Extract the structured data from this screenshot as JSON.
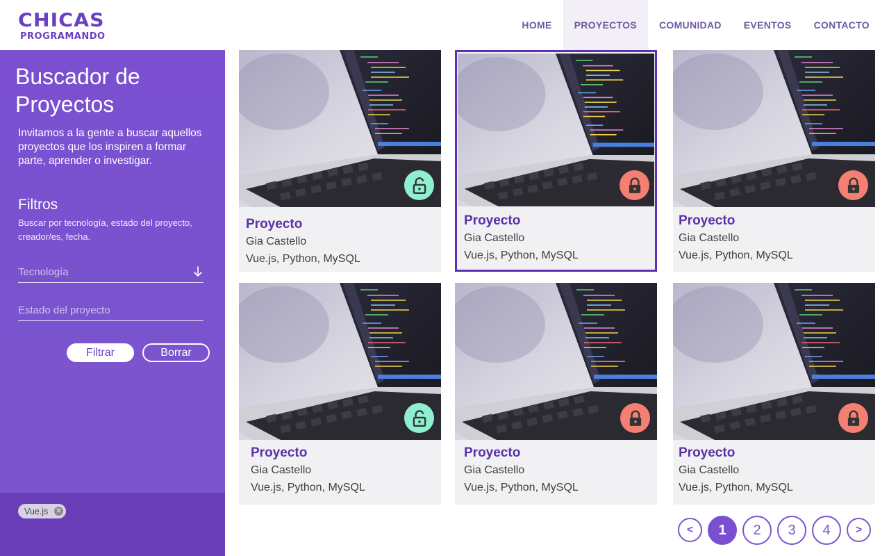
{
  "header": {
    "logo_line1": "CHICAS",
    "logo_line2": "PROGRAMANDO",
    "nav": [
      {
        "label": "HOME"
      },
      {
        "label": "PROYECTOS"
      },
      {
        "label": "COMUNIDAD"
      },
      {
        "label": "EVENTOS"
      },
      {
        "label": "CONTACTO"
      }
    ],
    "active_nav": "PROYECTOS"
  },
  "sidebar": {
    "title": "Buscador de Proyectos",
    "intro": "Invitamos a la gente a buscar aquellos proyectos que los inspiren a formar parte, aprender o investigar.",
    "filters_title": "Filtros",
    "filters_desc": "Buscar por tecnología, estado del proyecto, creador/es, fecha.",
    "tecnologia_placeholder": "Tecnología",
    "estado_placeholder": "Estado del proyecto",
    "filter_button": "Filtrar",
    "clear_button": "Borrar",
    "active_tags": [
      {
        "label": "Vue.js"
      }
    ]
  },
  "cards": [
    {
      "title": "Proyecto",
      "author": "Gia Castello",
      "tech": "Vue.js, Python, MySQL",
      "lock": "lock-open-icon",
      "lock_color": "#8ef0d1"
    },
    {
      "title": "Proyecto",
      "author": "Gia Castello",
      "tech": "Vue.js, Python, MySQL",
      "lock": "lock-closed-icon",
      "lock_color": "#f57f73",
      "selected": true
    },
    {
      "title": "Proyecto",
      "author": "Gia Castello",
      "tech": "Vue.js, Python, MySQL",
      "lock": "lock-closed-icon",
      "lock_color": "#f57f73"
    },
    {
      "title": "Proyecto",
      "author": "Gia Castello",
      "tech": "Vue.js, Python, MySQL",
      "lock": "lock-open-icon",
      "lock_color": "#8ef0d1"
    },
    {
      "title": "Proyecto",
      "author": "Gia Castello",
      "tech": "Vue.js, Python, MySQL",
      "lock": "lock-closed-icon",
      "lock_color": "#f57f73"
    },
    {
      "title": "Proyecto",
      "author": "Gia Castello",
      "tech": "Vue.js, Python, MySQL",
      "lock": "lock-closed-icon",
      "lock_color": "#f57f73"
    }
  ],
  "pagination": {
    "prev": "<",
    "pages": [
      "1",
      "2",
      "3",
      "4"
    ],
    "current": "1",
    "next": ">"
  },
  "colors": {
    "brand_purple": "#7a50d1",
    "title_purple": "#5a32a8",
    "tag_bar": "#6a3db8",
    "lock_open": "#8ef0d1",
    "lock_closed": "#f57f73"
  }
}
